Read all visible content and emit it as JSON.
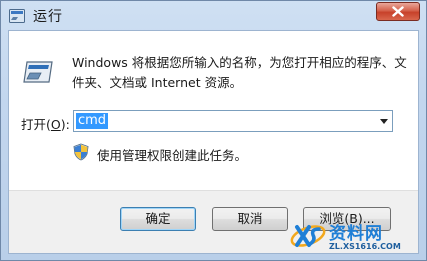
{
  "window": {
    "title": "运行"
  },
  "dialog": {
    "description": "Windows 将根据您所输入的名称，为您打开相应的程序、文件夹、文档或 Internet 资源。",
    "open_label_prefix": "打开(",
    "open_label_key": "O",
    "open_label_suffix": "):",
    "command_value": "cmd",
    "admin_note": "使用管理权限创建此任务。"
  },
  "buttons": {
    "ok": "确定",
    "cancel": "取消",
    "browse": "浏览(B)..."
  },
  "watermark": {
    "title": "资料网",
    "url": "ZL.XS1616.COM"
  },
  "icons": {
    "title": "run-icon",
    "close": "close-icon",
    "main": "run-icon",
    "admin": "shield-icon",
    "dropdown": "chevron-down-icon"
  }
}
